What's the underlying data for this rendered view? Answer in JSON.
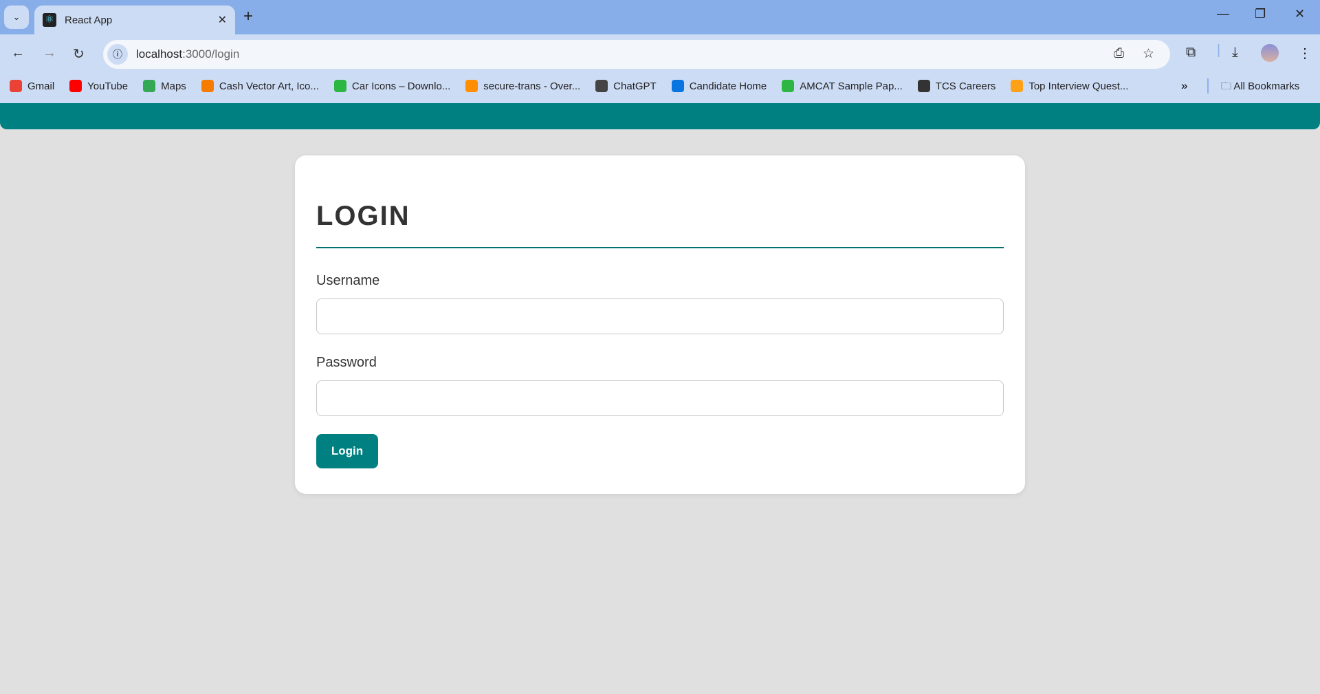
{
  "browser": {
    "tab_title": "React App",
    "url_host": "localhost",
    "url_path": ":3000/login",
    "bookmarks": [
      {
        "label": "Gmail",
        "icon": "gmail-icon",
        "color": "#ea4335"
      },
      {
        "label": "YouTube",
        "icon": "youtube-icon",
        "color": "#ff0000"
      },
      {
        "label": "Maps",
        "icon": "maps-icon",
        "color": "#34a853"
      },
      {
        "label": "Cash Vector Art, Ico...",
        "icon": "vecteezy-icon",
        "color": "#f57c00"
      },
      {
        "label": "Car Icons – Downlo...",
        "icon": "flaticon-icon",
        "color": "#2db742"
      },
      {
        "label": "secure-trans - Over...",
        "icon": "firebase-icon",
        "color": "#ff8f00"
      },
      {
        "label": "ChatGPT",
        "icon": "chatgpt-icon",
        "color": "#444444"
      },
      {
        "label": "Candidate Home",
        "icon": "workday-icon",
        "color": "#0875e1"
      },
      {
        "label": "AMCAT Sample Pap...",
        "icon": "amcat-icon",
        "color": "#2db742"
      },
      {
        "label": "TCS Careers",
        "icon": "globe-icon",
        "color": "#333333"
      },
      {
        "label": "Top Interview Quest...",
        "icon": "leetcode-icon",
        "color": "#ffa116"
      }
    ],
    "all_bookmarks": "All Bookmarks"
  },
  "colors": {
    "accent": "#008080",
    "background": "#e0e0e0"
  },
  "login": {
    "title": "LOGIN",
    "username_label": "Username",
    "username_value": "",
    "password_label": "Password",
    "password_value": "",
    "button_label": "Login"
  }
}
